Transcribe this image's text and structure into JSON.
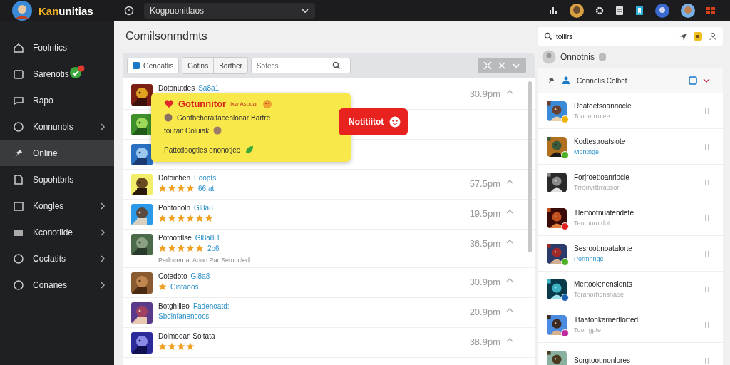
{
  "logo": {
    "accent": "Kan",
    "rest": "unitias"
  },
  "top_dropdown": {
    "value": "Kogpuonitlaos"
  },
  "sidebar": {
    "items": [
      {
        "label": "Foolntics",
        "selected": false,
        "chevron": false
      },
      {
        "label": "Sarenotis",
        "selected": false,
        "chevron": false,
        "badge": true
      },
      {
        "label": "Rapo",
        "selected": false,
        "chevron": false
      },
      {
        "label": "Konnunbls",
        "selected": false,
        "chevron": true
      },
      {
        "label": "Online",
        "selected": true,
        "chevron": false
      },
      {
        "label": "Sopohtbrls",
        "selected": false,
        "chevron": false
      },
      {
        "label": "Kongles",
        "selected": false,
        "chevron": true
      },
      {
        "label": "Kconotiide",
        "selected": false,
        "chevron": true
      },
      {
        "label": "Coclatits",
        "selected": false,
        "chevron": true
      },
      {
        "label": "Conanes",
        "selected": false,
        "chevron": true
      }
    ]
  },
  "page_title": "Comilsonmdmts",
  "filters": {
    "chip": "Genoatlis",
    "segments": [
      "Gofins",
      "Borther"
    ],
    "search_placeholder": "Sotecs"
  },
  "rows": [
    {
      "title": "Dotonutdes",
      "tag": "Sa8a1",
      "time": "30.9pm"
    },
    {},
    {},
    {
      "title": "Dotoichen",
      "tag": "Eoopts",
      "time": "57.5pm",
      "stars": 4,
      "extra": "66 at"
    },
    {
      "title": "Pohtonoln",
      "tag": "Gl8a8",
      "time": "19.5pm",
      "stars": 6
    },
    {
      "title": "Potootitlse",
      "tag": "Gl8a8 1",
      "time": "36.5pm",
      "stars": 5,
      "extra": "2b6",
      "note": "Parloceruat Aooo Par Semncled"
    },
    {
      "title": "Cotedoto",
      "tag": "Gl8a8",
      "time": "30.9pm",
      "extra": "Gisfaoos"
    },
    {
      "title": "Botghilleo",
      "tag": "Fadenoatd:",
      "time": "20.9pm",
      "extra": "Sbdlnfanencocs"
    },
    {
      "title": "Dolmodan Soltata",
      "time": "38.9pm",
      "stars": 4
    }
  ],
  "tooltip": {
    "title": "Gotunnitor",
    "subtitle": "ixw Asbdar",
    "line_1": "Gontbchoraltacenlonar Bartre",
    "line_2": "foutait Coluiak",
    "line_3": "Pattcdoogtles enonotjec"
  },
  "notification": {
    "label": "Notitiitot"
  },
  "right_search": {
    "value": "tolllrs"
  },
  "profile": {
    "name": "Onnotnis"
  },
  "friends_header": "Connolis Colbet",
  "friends": [
    {
      "name": "Reatoetsoanriocle",
      "sub": "Toooorrrolee",
      "kind": "muted",
      "color": "#f0b400"
    },
    {
      "name": "Kodtestroatsiote",
      "sub": "Montnge",
      "kind": "link",
      "color": "#4caf24"
    },
    {
      "name": "Forjroet:oanriocle",
      "sub": "Trrorrvrttrraosor",
      "kind": "muted"
    },
    {
      "name": "Tlertootnuatendete",
      "sub": "Teoroorotdot",
      "kind": "muted",
      "color": "#e02020"
    },
    {
      "name": "Sesroot:noatalorte",
      "sub": "Pormnnge",
      "kind": "link",
      "color": "#4caf24"
    },
    {
      "name": "Mertook:nensients",
      "sub": "Toranorhdnsnaoe",
      "kind": "muted",
      "color": "#1a60b0"
    },
    {
      "name": "Ttaatonkarnerflorted",
      "sub": "Toorrgpte",
      "kind": "muted",
      "color": "#c02aa0"
    },
    {
      "name": "Sorgtoot:nonlores"
    }
  ]
}
